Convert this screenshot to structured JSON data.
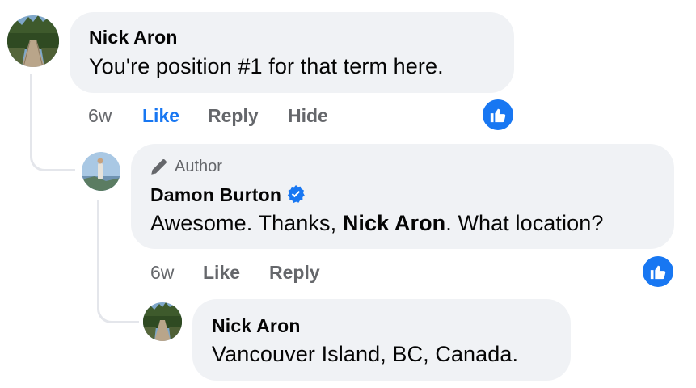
{
  "comments": [
    {
      "author": "Nick Aron",
      "text": "You're position #1 for that term here.",
      "time": "6w",
      "like_label": "Like",
      "reply_label": "Reply",
      "hide_label": "Hide",
      "liked": true
    },
    {
      "author_tag": "Author",
      "author": "Damon Burton",
      "verified": true,
      "text_before": "Awesome. Thanks, ",
      "mention": "Nick Aron",
      "text_after": ". What location?",
      "time": "6w",
      "like_label": "Like",
      "reply_label": "Reply"
    },
    {
      "author": "Nick Aron",
      "text": "Vancouver Island, BC, Canada."
    }
  ],
  "colors": {
    "accent": "#1877f2",
    "bubble": "#f0f2f5",
    "meta": "#65676b",
    "thread": "#e4e6eb"
  },
  "icons": [
    "avatar-nick-aron",
    "pencil-icon",
    "verified-badge-icon",
    "like-reaction-icon"
  ]
}
